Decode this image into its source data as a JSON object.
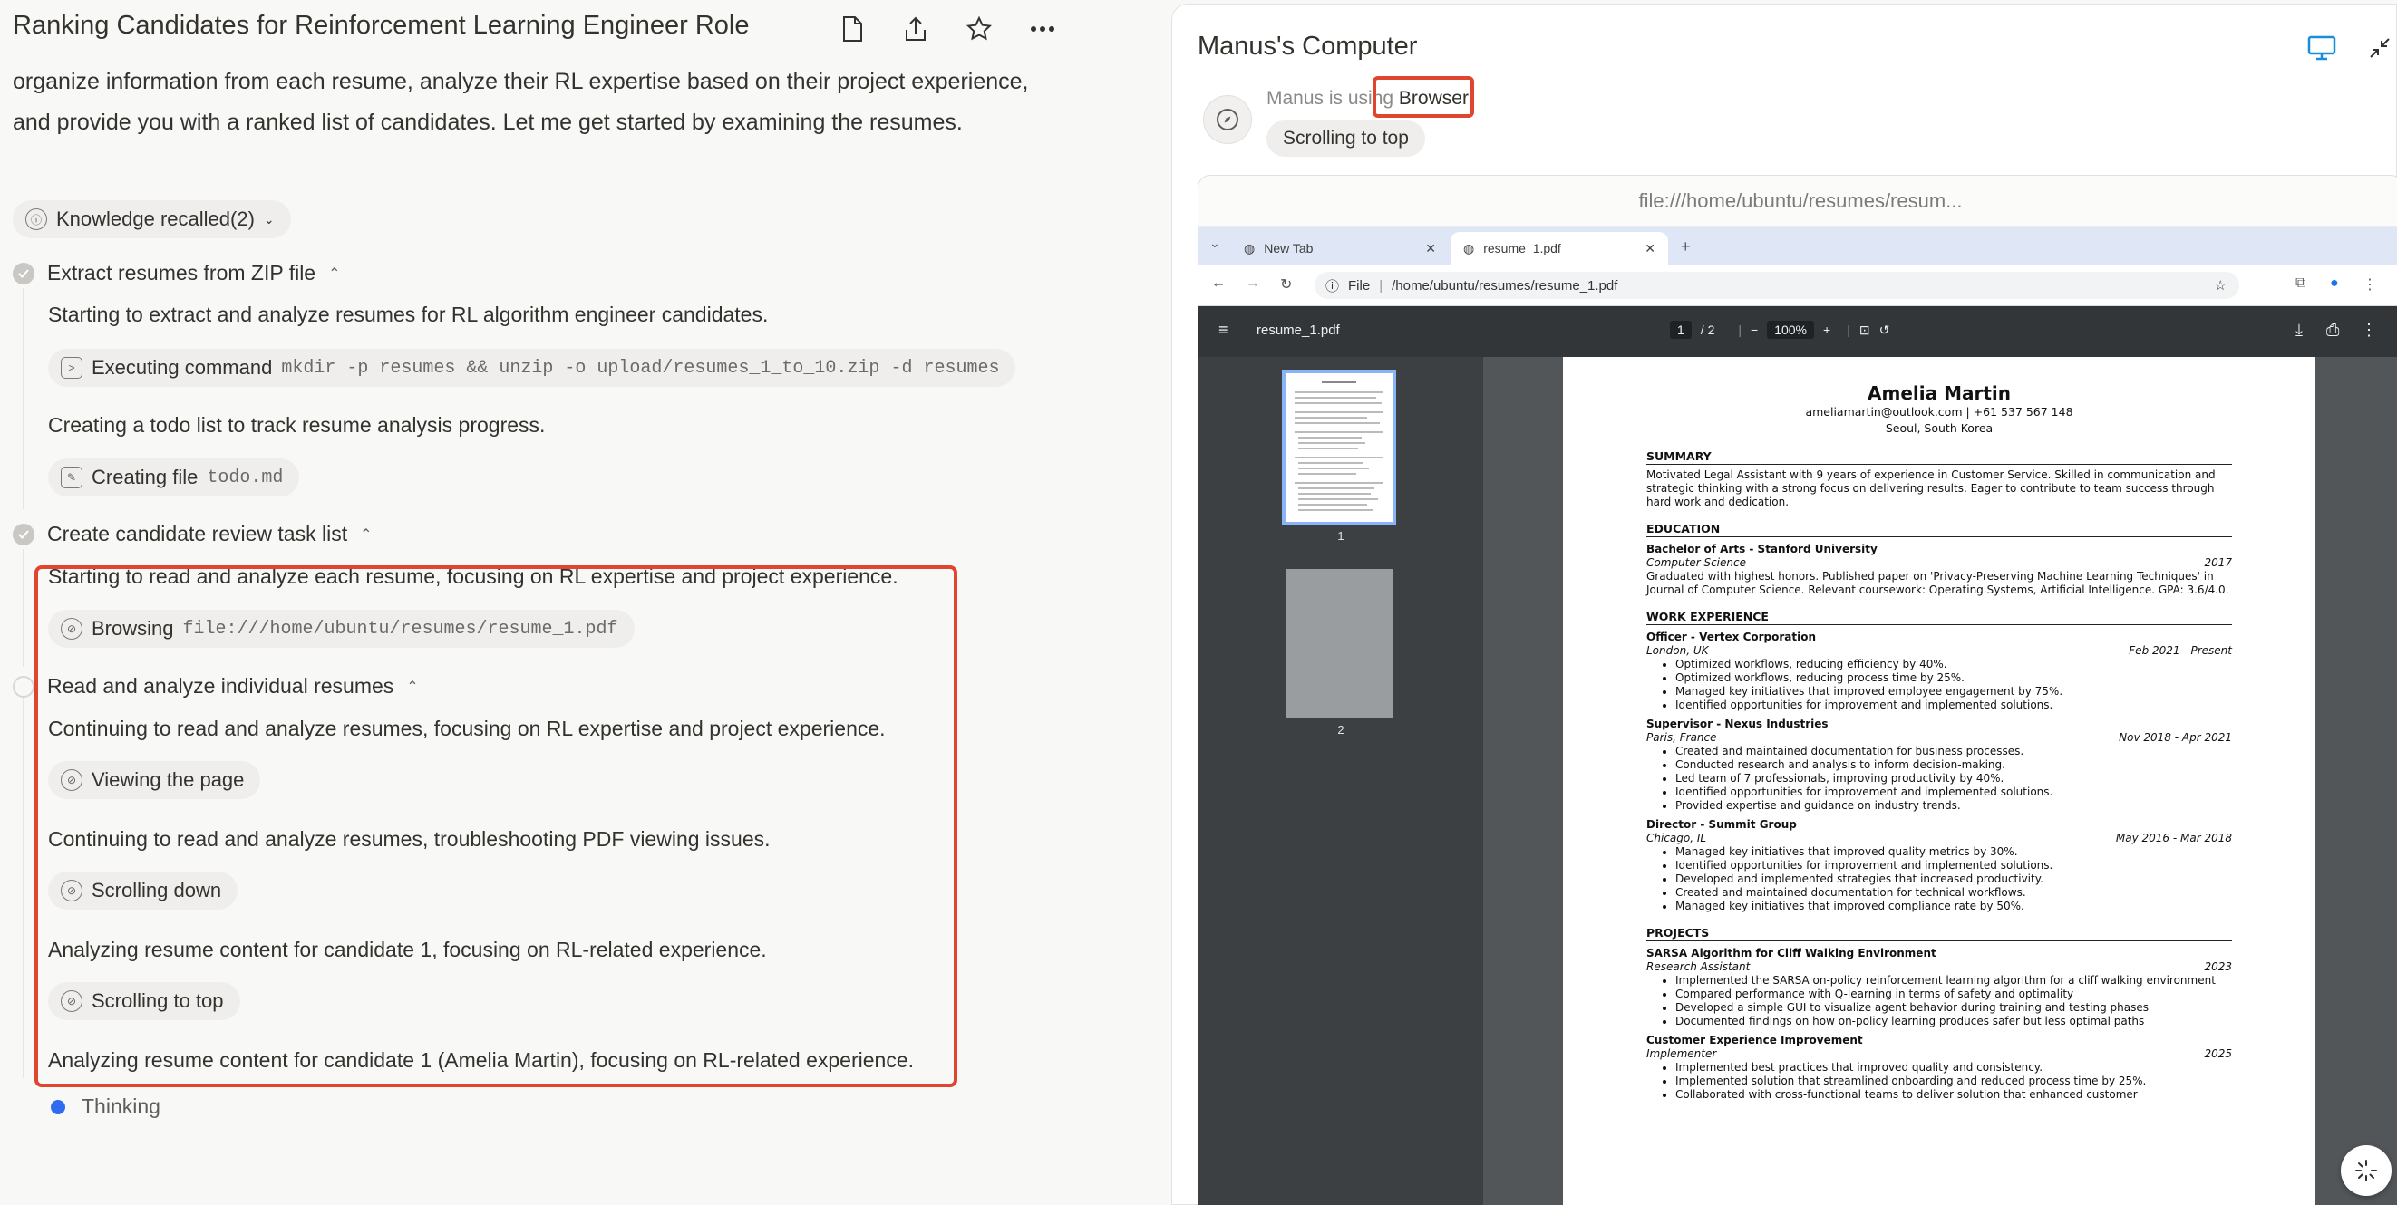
{
  "chat": {
    "title": "Ranking Candidates for Reinforcement Learning Engineer Role",
    "intro": "organize information from each resume, analyze their RL expertise based on their project experience, and provide you with a ranked list of candidates. Let me get started by examining the resumes.",
    "knowledge": "Knowledge recalled(2)",
    "step1": {
      "title": "Extract resumes from ZIP file",
      "line1": "Starting to extract and analyze resumes for RL algorithm engineer candidates.",
      "cmd_label": "Executing command",
      "cmd_code": "mkdir -p resumes && unzip -o upload/resumes_1_to_10.zip -d resumes",
      "line2": "Creating a todo list to track resume analysis progress.",
      "file_label": "Creating file",
      "file_code": "todo.md"
    },
    "step2": {
      "title": "Create candidate review task list",
      "line1": "Starting to read and analyze each resume, focusing on RL expertise and project experience.",
      "browse_label": "Browsing",
      "browse_code": "file:///home/ubuntu/resumes/resume_1.pdf"
    },
    "step3": {
      "title": "Read and analyze individual resumes",
      "line1": "Continuing to read and analyze resumes, focusing on RL expertise and project experience.",
      "pill1": "Viewing the page",
      "line2": "Continuing to read and analyze resumes, troubleshooting PDF viewing issues.",
      "pill2": "Scrolling down",
      "line3": "Analyzing resume content for candidate 1, focusing on RL-related experience.",
      "pill3": "Scrolling to top",
      "line4": "Analyzing resume content for candidate 1 (Amelia Martin), focusing on RL-related experience."
    },
    "thinking": "Thinking"
  },
  "computer": {
    "title": "Manus's Computer",
    "using_prefix": "Manus is using",
    "using_tool": "Browser",
    "action": "Scrolling to top",
    "url_caption": "file:///home/ubuntu/resumes/resum...",
    "browser": {
      "tabs": [
        "New Tab",
        "resume_1.pdf"
      ],
      "addr_scheme": "File",
      "addr_path": "/home/ubuntu/resumes/resume_1.pdf",
      "pdf_name": "resume_1.pdf",
      "page_current": "1",
      "page_total": "/ 2",
      "zoom": "100%",
      "thumbs": [
        "1",
        "2"
      ]
    },
    "resume": {
      "name": "Amelia Martin",
      "contact": "ameliamartin@outlook.com | +61 537 567 148",
      "location": "Seoul, South Korea",
      "summary_h": "SUMMARY",
      "summary": "Motivated Legal Assistant with 9 years of experience in Customer Service. Skilled in communication and strategic thinking with a strong focus on delivering results. Eager to contribute to team success through hard work and dedication.",
      "education_h": "EDUCATION",
      "edu_degree": "Bachelor of Arts - Stanford University",
      "edu_field": "Computer Science",
      "edu_year": "2017",
      "edu_text": "Graduated with highest honors. Published paper on 'Privacy-Preserving Machine Learning Techniques' in Journal of Computer Science. Relevant coursework: Operating Systems, Artificial Intelligence. GPA: 3.6/4.0.",
      "work_h": "WORK EXPERIENCE",
      "job1": {
        "title": "Officer - Vertex Corporation",
        "loc": "London, UK",
        "dates": "Feb 2021 - Present",
        "bullets": [
          "Optimized workflows, reducing efficiency by 40%.",
          "Optimized workflows, reducing process time by 25%.",
          "Managed key initiatives that improved employee engagement by 75%.",
          "Identified opportunities for improvement and implemented solutions."
        ]
      },
      "job2": {
        "title": "Supervisor - Nexus Industries",
        "loc": "Paris, France",
        "dates": "Nov 2018 - Apr 2021",
        "bullets": [
          "Created and maintained documentation for business processes.",
          "Conducted research and analysis to inform decision-making.",
          "Led team of 7 professionals, improving productivity by 40%.",
          "Identified opportunities for improvement and implemented solutions.",
          "Provided expertise and guidance on industry trends."
        ]
      },
      "job3": {
        "title": "Director - Summit Group",
        "loc": "Chicago, IL",
        "dates": "May 2016 - Mar 2018",
        "bullets": [
          "Managed key initiatives that improved quality metrics by 30%.",
          "Identified opportunities for improvement and implemented solutions.",
          "Developed and implemented strategies that increased productivity.",
          "Created and maintained documentation for technical workflows.",
          "Managed key initiatives that improved compliance rate by 50%."
        ]
      },
      "projects_h": "PROJECTS",
      "proj1": {
        "title": "SARSA Algorithm for Cliff Walking Environment",
        "role": "Research Assistant",
        "year": "2023",
        "bullets": [
          "Implemented the SARSA on-policy reinforcement learning algorithm for a cliff walking environment",
          "Compared performance with Q-learning in terms of safety and optimality",
          "Developed a simple GUI to visualize agent behavior during training and testing phases",
          "Documented findings on how on-policy learning produces safer but less optimal paths"
        ]
      },
      "proj2": {
        "title": "Customer Experience Improvement",
        "role": "Implementer",
        "year": "2025",
        "bullets": [
          "Implemented best practices that improved quality and consistency.",
          "Implemented solution that streamlined onboarding and reduced process time by 25%.",
          "Collaborated with cross-functional teams to deliver solution that enhanced customer"
        ]
      }
    }
  }
}
